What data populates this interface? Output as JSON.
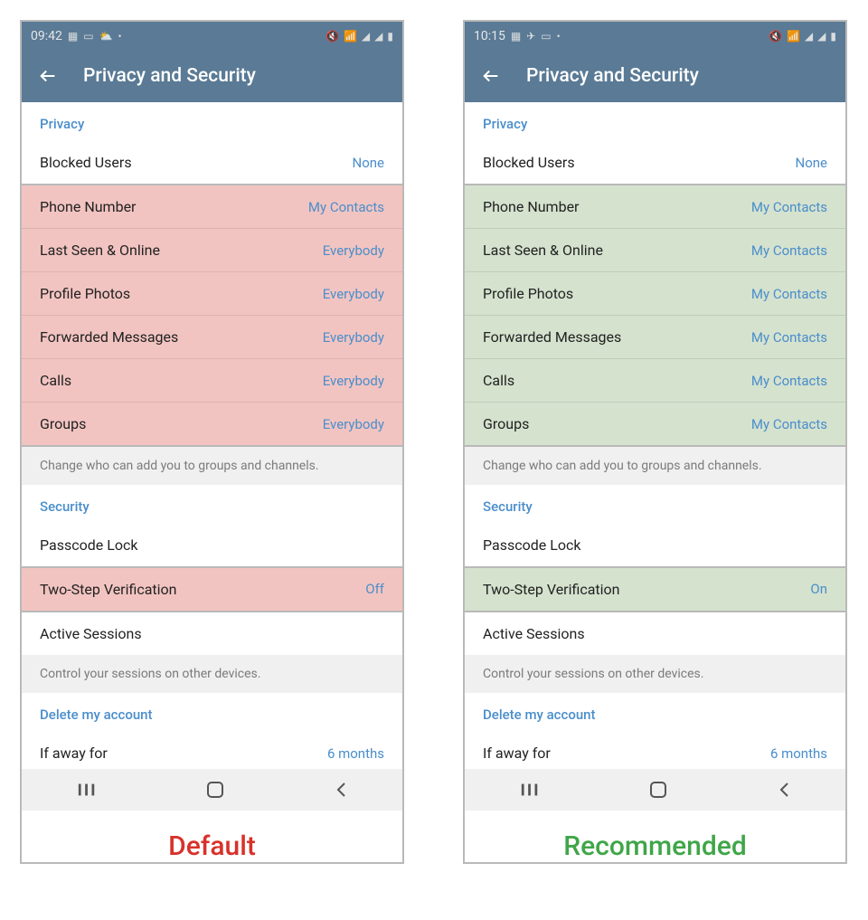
{
  "left": {
    "caption": "Default",
    "status": {
      "time": "09:42"
    },
    "header": {
      "title": "Privacy and Security"
    },
    "privacy": {
      "header": "Privacy",
      "blocked": {
        "label": "Blocked Users",
        "value": "None"
      },
      "items": [
        {
          "label": "Phone Number",
          "value": "My Contacts"
        },
        {
          "label": "Last Seen & Online",
          "value": "Everybody"
        },
        {
          "label": "Profile Photos",
          "value": "Everybody"
        },
        {
          "label": "Forwarded Messages",
          "value": "Everybody"
        },
        {
          "label": "Calls",
          "value": "Everybody"
        },
        {
          "label": "Groups",
          "value": "Everybody"
        }
      ],
      "note": "Change who can add you to groups and channels."
    },
    "security": {
      "header": "Security",
      "passcode": {
        "label": "Passcode Lock"
      },
      "twostep": {
        "label": "Two-Step Verification",
        "value": "Off"
      },
      "active": {
        "label": "Active Sessions"
      },
      "note": "Control your sessions on other devices."
    },
    "delete": {
      "header": "Delete my account",
      "away": {
        "label": "If away for",
        "value": "6 months"
      }
    }
  },
  "right": {
    "caption": "Recommended",
    "status": {
      "time": "10:15"
    },
    "header": {
      "title": "Privacy and Security"
    },
    "privacy": {
      "header": "Privacy",
      "blocked": {
        "label": "Blocked Users",
        "value": "None"
      },
      "items": [
        {
          "label": "Phone Number",
          "value": "My Contacts"
        },
        {
          "label": "Last Seen & Online",
          "value": "My Contacts"
        },
        {
          "label": "Profile Photos",
          "value": "My Contacts"
        },
        {
          "label": "Forwarded Messages",
          "value": "My Contacts"
        },
        {
          "label": "Calls",
          "value": "My Contacts"
        },
        {
          "label": "Groups",
          "value": "My Contacts"
        }
      ],
      "note": "Change who can add you to groups and channels."
    },
    "security": {
      "header": "Security",
      "passcode": {
        "label": "Passcode Lock"
      },
      "twostep": {
        "label": "Two-Step Verification",
        "value": "On"
      },
      "active": {
        "label": "Active Sessions"
      },
      "note": "Control your sessions on other devices."
    },
    "delete": {
      "header": "Delete my account",
      "away": {
        "label": "If away for",
        "value": "6 months"
      }
    }
  }
}
